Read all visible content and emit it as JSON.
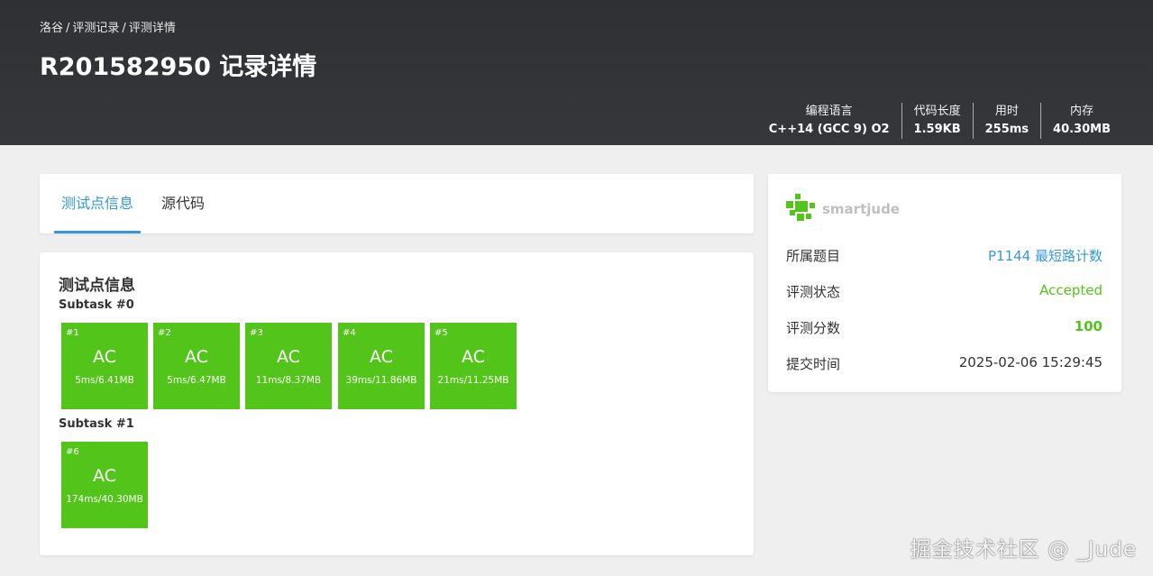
{
  "breadcrumb": {
    "home": "洛谷",
    "records": "评测记录",
    "current": "评测详情",
    "sep": "/"
  },
  "title": "R201582950 记录详情",
  "stats": [
    {
      "label": "编程语言",
      "value": "C++14 (GCC 9) O2"
    },
    {
      "label": "代码长度",
      "value": "1.59KB"
    },
    {
      "label": "用时",
      "value": "255ms"
    },
    {
      "label": "内存",
      "value": "40.30MB"
    }
  ],
  "tabs": {
    "testcases": "测试点信息",
    "source": "源代码"
  },
  "main": {
    "section_title": "测试点信息",
    "subtasks": [
      {
        "title": "Subtask #0",
        "cases": [
          {
            "num": "#1",
            "status": "AC",
            "detail": "5ms/6.41MB"
          },
          {
            "num": "#2",
            "status": "AC",
            "detail": "5ms/6.47MB"
          },
          {
            "num": "#3",
            "status": "AC",
            "detail": "11ms/8.37MB"
          },
          {
            "num": "#4",
            "status": "AC",
            "detail": "39ms/11.86MB"
          },
          {
            "num": "#5",
            "status": "AC",
            "detail": "21ms/11.25MB"
          }
        ]
      },
      {
        "title": "Subtask #1",
        "cases": [
          {
            "num": "#6",
            "status": "AC",
            "detail": "174ms/40.30MB"
          }
        ]
      }
    ]
  },
  "side": {
    "username": "smartjude",
    "rows": {
      "problem": {
        "label": "所属题目",
        "value": "P1144 最短路计数"
      },
      "status": {
        "label": "评测状态",
        "value": "Accepted"
      },
      "score": {
        "label": "评测分数",
        "value": "100"
      },
      "time": {
        "label": "提交时间",
        "value": "2025-02-06 15:29:45"
      }
    }
  },
  "colors": {
    "accepted": "#52c41a",
    "link": "#3498db",
    "header": "#333538"
  },
  "watermark": "掘金技术社区 @ _Jude"
}
